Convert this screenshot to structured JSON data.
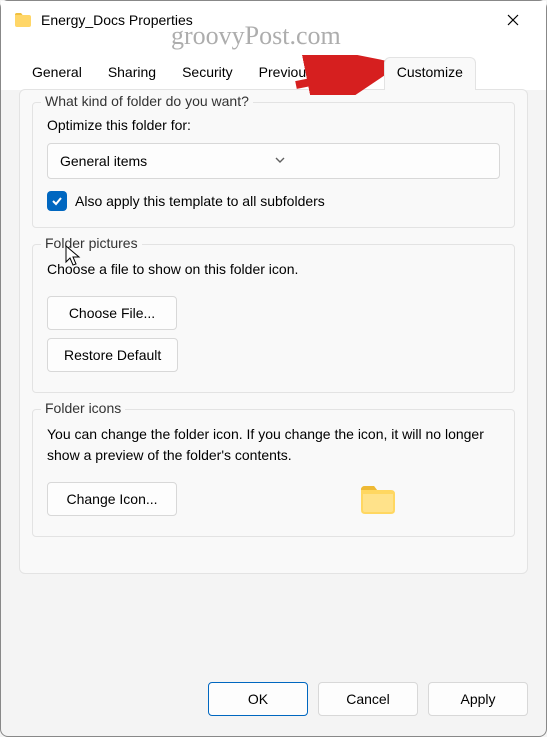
{
  "window": {
    "title": "Energy_Docs Properties",
    "watermark": "groovyPost.com"
  },
  "tabs": {
    "general": "General",
    "sharing": "Sharing",
    "security": "Security",
    "previous_versions": "Previous Versions",
    "customize": "Customize"
  },
  "customize": {
    "kind_legend": "What kind of folder do you want?",
    "optimize_label": "Optimize this folder for:",
    "optimize_value": "General items",
    "subfolders": "Also apply this template to all subfolders",
    "pictures_legend": "Folder pictures",
    "pictures_desc": "Choose a file to show on this folder icon.",
    "choose_file": "Choose File...",
    "restore_default": "Restore Default",
    "icons_legend": "Folder icons",
    "icons_desc": "You can change the folder icon. If you change the icon, it will no longer show a preview of the folder's contents.",
    "change_icon": "Change Icon..."
  },
  "actions": {
    "ok": "OK",
    "cancel": "Cancel",
    "apply": "Apply"
  }
}
